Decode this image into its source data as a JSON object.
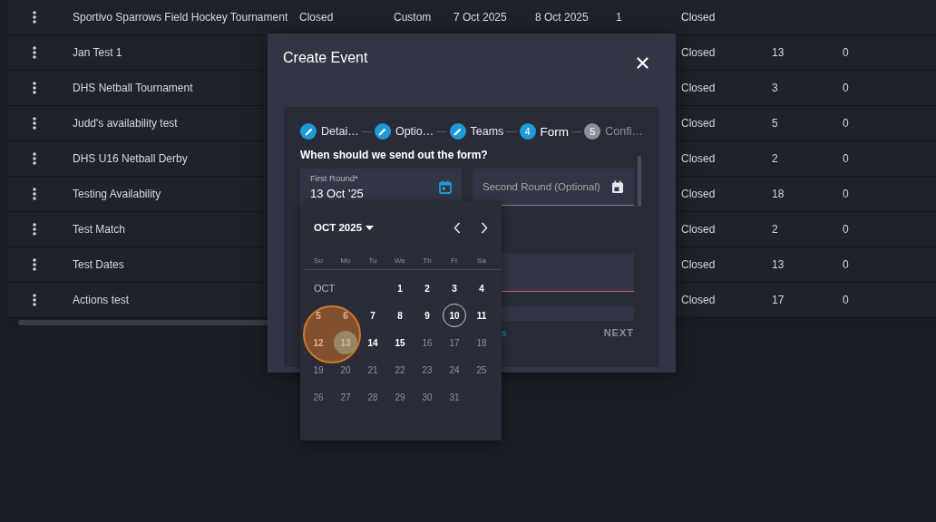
{
  "table": {
    "rows": [
      {
        "name": "Sportivo Sparrows Field Hockey Tournament",
        "status": "Closed",
        "column_3": "Custom",
        "column_4": "7 Oct 2025",
        "column_5": "8 Oct 2025",
        "column_6": "1",
        "column_7": "Closed"
      },
      {
        "name": "Jan Test 1",
        "column_7": "Closed",
        "column_8": "13",
        "column_9": "0"
      },
      {
        "name": "DHS Netball Tournament",
        "column_7": "Closed",
        "column_8": "3",
        "column_9": "0"
      },
      {
        "name": "Judd's availability test",
        "column_7": "Closed",
        "column_8": "5",
        "column_9": "0"
      },
      {
        "name": "DHS U16 Netball Derby",
        "column_7": "Closed",
        "column_8": "2",
        "column_9": "0"
      },
      {
        "name": "Testing Availability",
        "column_7": "Closed",
        "column_8": "18",
        "column_9": "0"
      },
      {
        "name": "Test Match",
        "column_7": "Closed",
        "column_8": "2",
        "column_9": "0"
      },
      {
        "name": "Test Dates",
        "column_7": "Closed",
        "column_8": "13",
        "column_9": "0"
      },
      {
        "name": "Actions test",
        "column_7": "Closed",
        "column_8": "17",
        "column_9": "0"
      }
    ]
  },
  "dialog": {
    "title": "Create Event",
    "steps": [
      {
        "label": "Detai…",
        "completed": true,
        "selected": false
      },
      {
        "label": "Optio…",
        "completed": true,
        "selected": false
      },
      {
        "label": "Teams",
        "completed": true,
        "selected": false
      },
      {
        "label": "Form",
        "number": "4",
        "completed": false,
        "selected": true
      },
      {
        "label": "Confi…",
        "number": "5",
        "completed": false,
        "selected": false
      }
    ],
    "question": "When should we send out the form?",
    "first_round": {
      "label": "First Round*",
      "value": "13 Oct '25"
    },
    "second_round": {
      "placeholder": "Second Round (Optional)"
    },
    "footer_link": "s",
    "next_button": "NEXT"
  },
  "calendar": {
    "month": "OCT 2025",
    "weekdays": [
      "Su",
      "Mo",
      "Tu",
      "We",
      "Th",
      "Fr",
      "Sa"
    ],
    "month_label": "OCT",
    "days": [
      {
        "d": "1",
        "selected": false,
        "today": false,
        "disabled": false
      },
      {
        "d": "2",
        "selected": false,
        "today": false,
        "disabled": false
      },
      {
        "d": "3",
        "selected": false,
        "today": false,
        "disabled": false
      },
      {
        "d": "4",
        "selected": false,
        "today": false,
        "disabled": false
      },
      {
        "d": "5",
        "selected": false,
        "today": false,
        "disabled": false
      },
      {
        "d": "6",
        "selected": false,
        "today": false,
        "disabled": false
      },
      {
        "d": "7",
        "selected": false,
        "today": false,
        "disabled": false
      },
      {
        "d": "8",
        "selected": false,
        "today": false,
        "disabled": false
      },
      {
        "d": "9",
        "selected": false,
        "today": false,
        "disabled": false
      },
      {
        "d": "10",
        "selected": false,
        "today": true,
        "disabled": false
      },
      {
        "d": "11",
        "selected": false,
        "today": false,
        "disabled": false
      },
      {
        "d": "12",
        "selected": false,
        "today": false,
        "disabled": false
      },
      {
        "d": "13",
        "selected": true,
        "today": false,
        "disabled": false
      },
      {
        "d": "14",
        "selected": false,
        "today": false,
        "disabled": false
      },
      {
        "d": "15",
        "selected": false,
        "today": false,
        "disabled": false
      },
      {
        "d": "16",
        "selected": false,
        "today": false,
        "disabled": true
      },
      {
        "d": "17",
        "selected": false,
        "today": false,
        "disabled": true
      },
      {
        "d": "18",
        "selected": false,
        "today": false,
        "disabled": true
      },
      {
        "d": "19",
        "selected": false,
        "today": false,
        "disabled": true
      },
      {
        "d": "20",
        "selected": false,
        "today": false,
        "disabled": true
      },
      {
        "d": "21",
        "selected": false,
        "today": false,
        "disabled": true
      },
      {
        "d": "22",
        "selected": false,
        "today": false,
        "disabled": true
      },
      {
        "d": "23",
        "selected": false,
        "today": false,
        "disabled": true
      },
      {
        "d": "24",
        "selected": false,
        "today": false,
        "disabled": true
      },
      {
        "d": "25",
        "selected": false,
        "today": false,
        "disabled": true
      },
      {
        "d": "26",
        "selected": false,
        "today": false,
        "disabled": true
      },
      {
        "d": "27",
        "selected": false,
        "today": false,
        "disabled": true
      },
      {
        "d": "28",
        "selected": false,
        "today": false,
        "disabled": true
      },
      {
        "d": "29",
        "selected": false,
        "today": false,
        "disabled": true
      },
      {
        "d": "30",
        "selected": false,
        "today": false,
        "disabled": true
      },
      {
        "d": "31",
        "selected": false,
        "today": false,
        "disabled": true
      }
    ]
  }
}
